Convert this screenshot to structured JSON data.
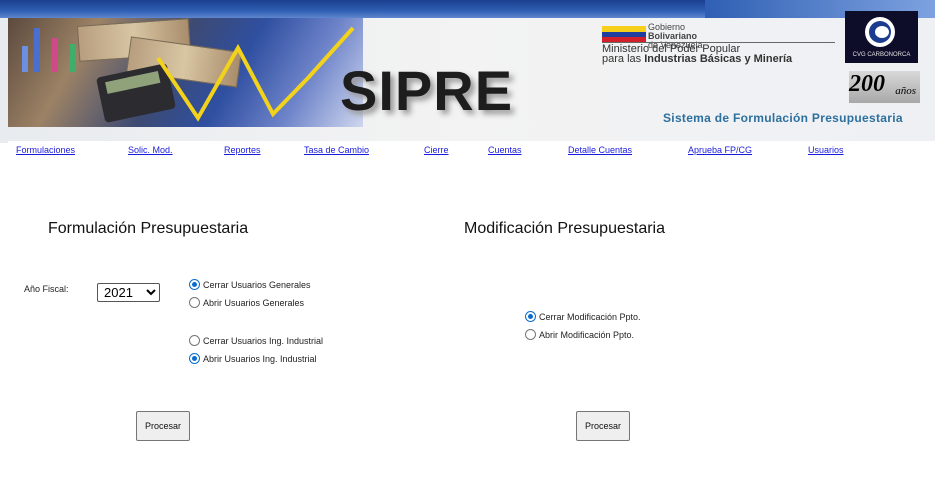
{
  "header": {
    "app_name": "SIPRE",
    "system_title": "Sistema de Formulación Presupuestaria",
    "gov_lines": [
      "Gobierno",
      "Bolivariano",
      "de Venezuela"
    ],
    "ministry_line1": "Ministerio del Poder Popular",
    "ministry_line2_prefix": "para las",
    "ministry_line2_bold": "Industrias Básicas y Minería",
    "cvg_text": "CVG CARBONORCA",
    "anniversary_number": "200",
    "anniversary_word": "años"
  },
  "nav": [
    {
      "label": "Formulaciones"
    },
    {
      "label": "Solic. Mod."
    },
    {
      "label": "Reportes"
    },
    {
      "label": "Tasa de Cambio"
    },
    {
      "label": "Cierre"
    },
    {
      "label": "Cuentas"
    },
    {
      "label": "Detalle Cuentas"
    },
    {
      "label": "Aprueba FP/CG"
    },
    {
      "label": "Usuarios"
    }
  ],
  "formulacion": {
    "title": "Formulación Presupuestaria",
    "year_label": "Año Fiscal:",
    "year_value": "2021",
    "options": [
      {
        "label": "Cerrar Usuarios Generales",
        "checked": true
      },
      {
        "label": "Abrir Usuarios Generales",
        "checked": false
      },
      {
        "label": "Cerrar Usuarios Ing. Industrial",
        "checked": false
      },
      {
        "label": "Abrir Usuarios Ing. Industrial",
        "checked": true
      }
    ],
    "button_label": "Procesar"
  },
  "modificacion": {
    "title": "Modificación Presupuestaria",
    "options": [
      {
        "label": "Cerrar Modificación Ppto.",
        "checked": true
      },
      {
        "label": "Abrir Modificación Ppto.",
        "checked": false
      }
    ],
    "button_label": "Procesar"
  },
  "colors": {
    "topbar": "#2f5fb3",
    "nav_link": "#1a1adb",
    "system_title": "#2d6f9d",
    "radio_checked": "#0a6ccf"
  }
}
